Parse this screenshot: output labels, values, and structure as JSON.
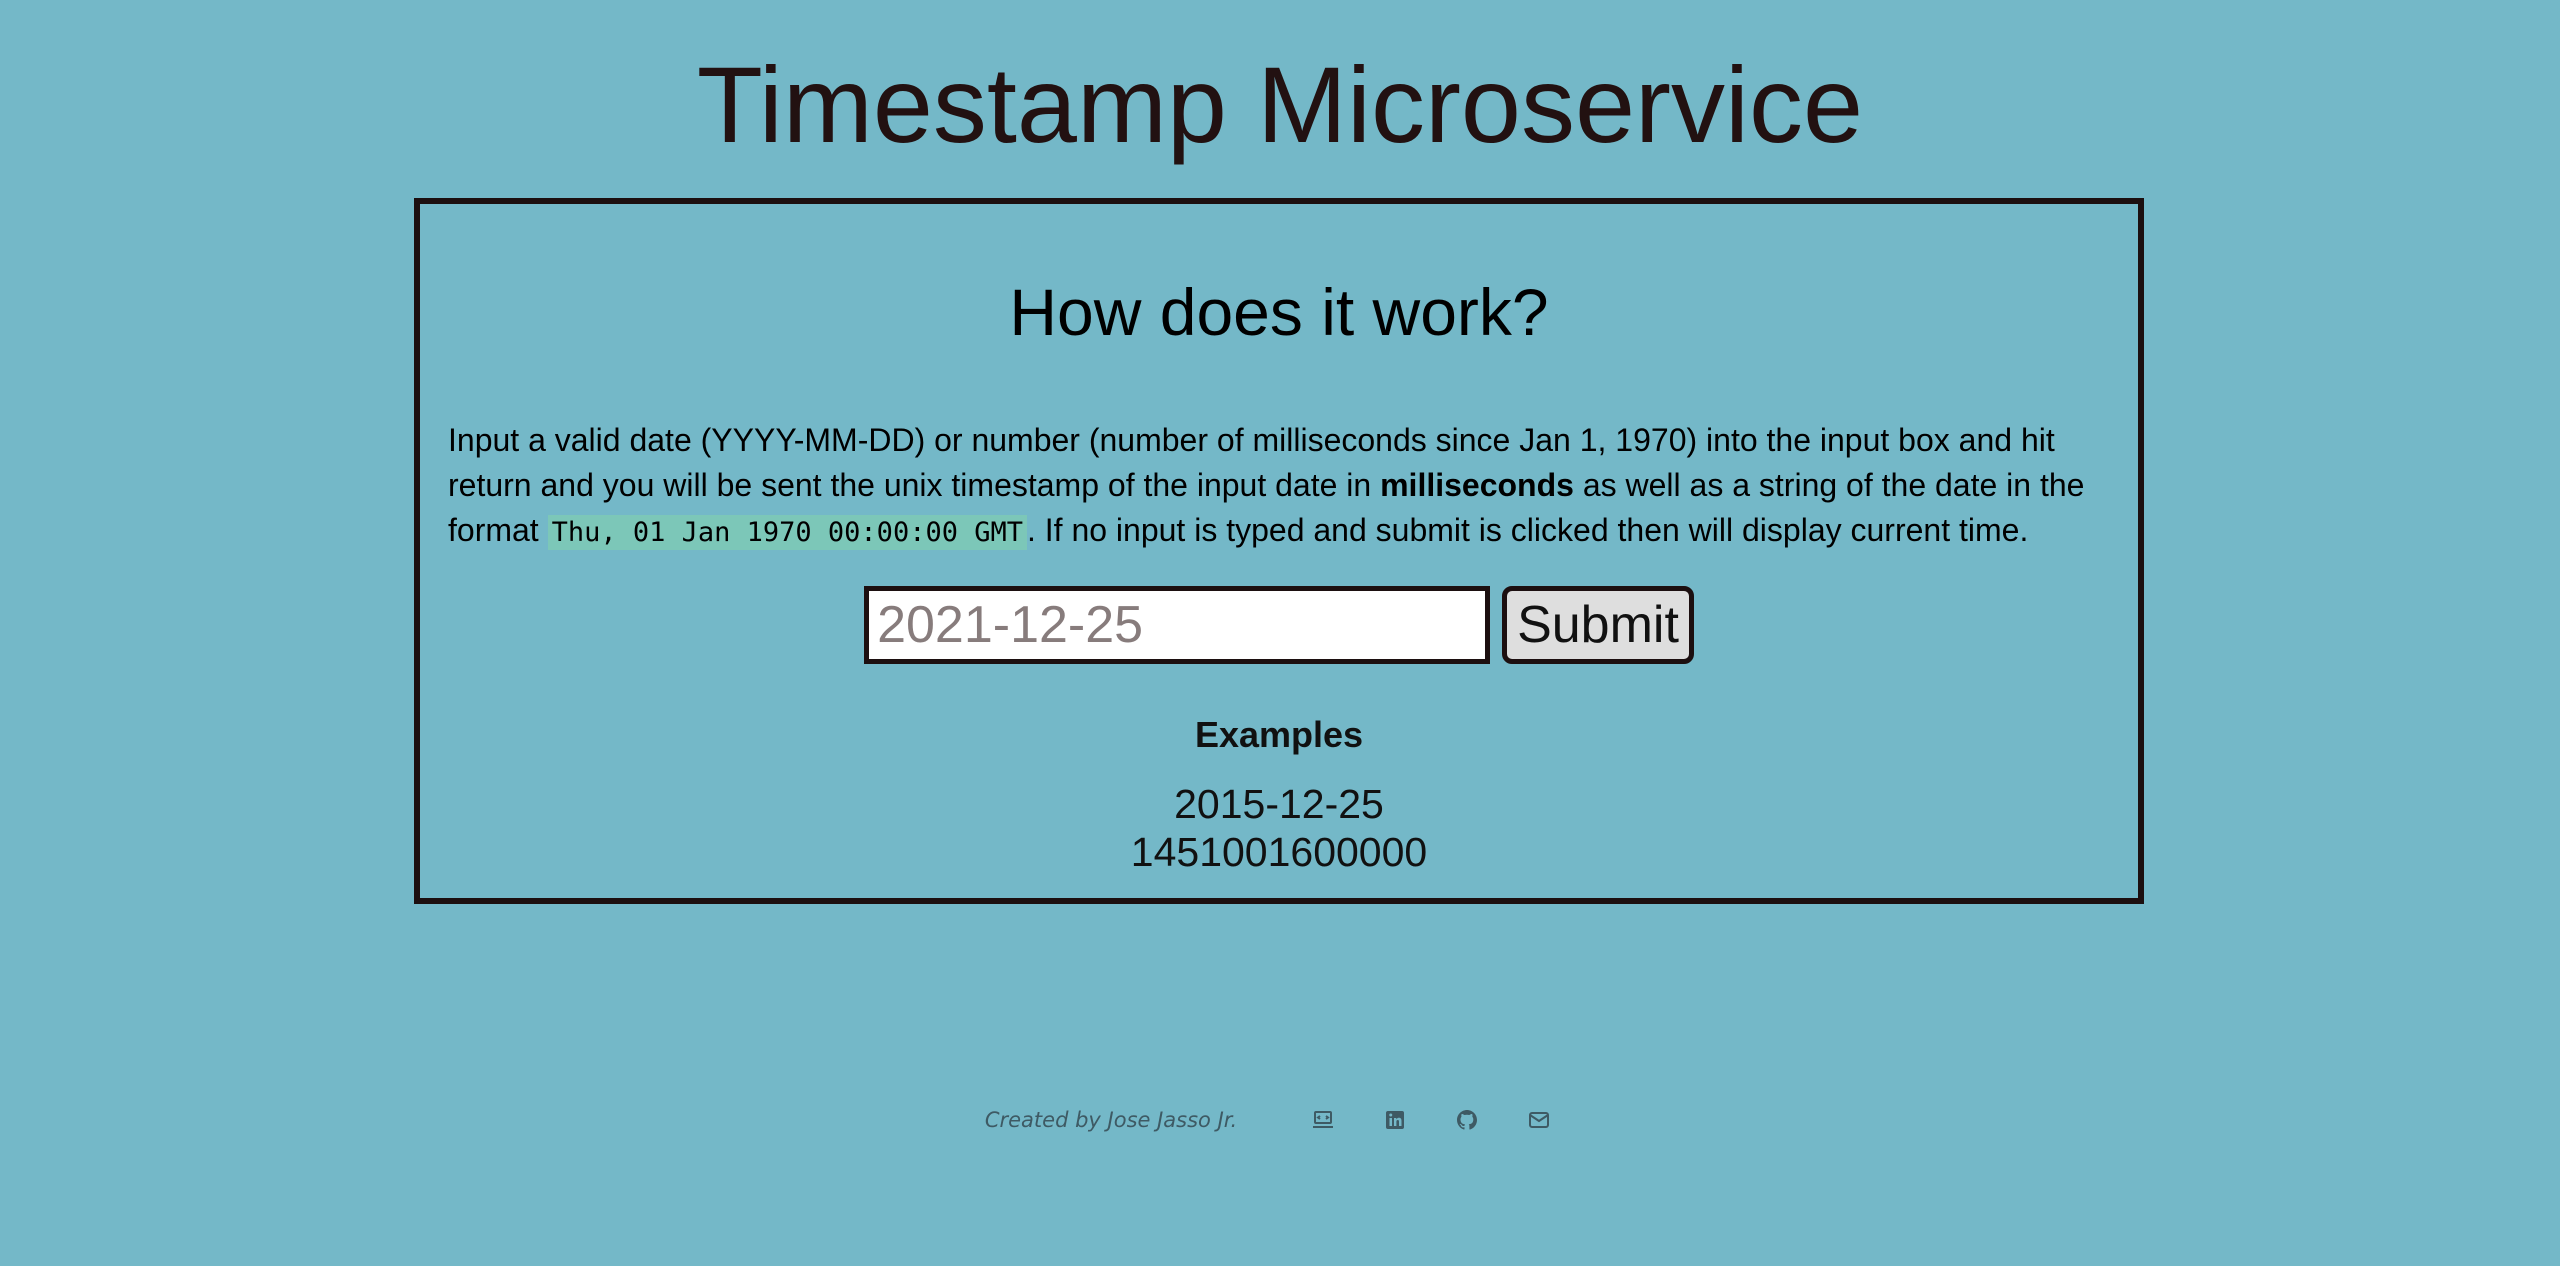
{
  "header": {
    "title": "Timestamp Microservice"
  },
  "card": {
    "heading": "How does it work?",
    "description": {
      "part1": "Input a valid date (YYYY-MM-DD) or number (number of milliseconds since Jan 1, 1970) into the input box and hit return and you will be sent the unix timestamp of the input date in ",
      "bold": "milliseconds",
      "part2": " as well as a string of the date in the format ",
      "code": "Thu, 01 Jan 1970 00:00:00 GMT",
      "part3": ". If no input is typed and submit is clicked then will display current time."
    },
    "form": {
      "input_value": "",
      "input_placeholder": "2021-12-25",
      "submit_label": "Submit"
    },
    "examples": {
      "heading": "Examples",
      "items": [
        "2015-12-25",
        "1451001600000"
      ]
    }
  },
  "footer": {
    "credit": "Created by Jose Jasso Jr.",
    "icons": [
      "portfolio-icon",
      "linkedin-icon",
      "github-icon",
      "email-icon"
    ]
  },
  "colors": {
    "background": "#74b8c8",
    "border": "#1c0f10",
    "code_highlight": "#7cc7b8",
    "footer_text": "#3e5a64"
  }
}
